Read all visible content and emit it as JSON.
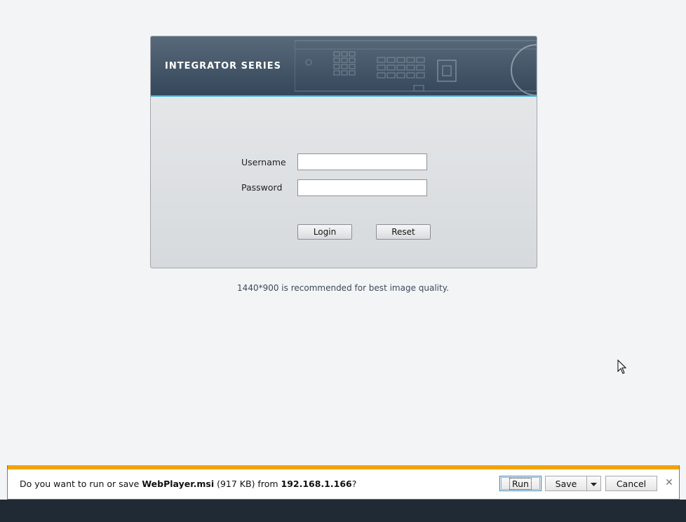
{
  "login": {
    "banner_title": "INTEGRATOR SERIES",
    "username_label": "Username",
    "password_label": "Password",
    "username_value": "",
    "password_value": "",
    "login_button": "Login",
    "reset_button": "Reset"
  },
  "recommendation": "1440*900 is recommended for best image quality.",
  "download_bar": {
    "prefix": "Do you want to run or save ",
    "file_name": "WebPlayer.msi",
    "file_size": " (917 KB) from ",
    "host": "192.168.1.166",
    "suffix": "?",
    "run_button": "Run",
    "save_button": "Save",
    "cancel_button": "Cancel",
    "close_icon": "close-icon",
    "dropdown_icon": "chevron-down-icon"
  },
  "colors": {
    "banner_accent": "#3cb0de",
    "download_accent": "#f1a400"
  }
}
